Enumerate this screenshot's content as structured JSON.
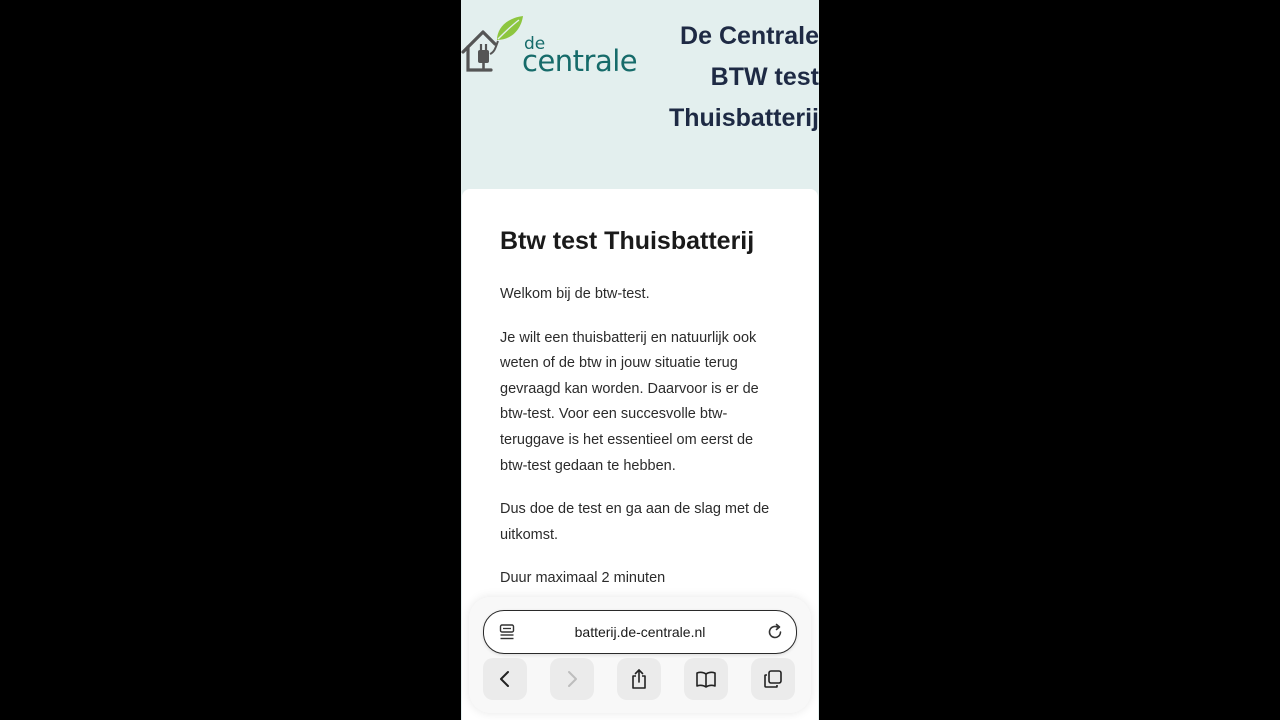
{
  "header": {
    "logo": {
      "small": "de",
      "large": "centrale"
    },
    "title_lines": [
      "De Centrale",
      "BTW test",
      "Thuisbatterij"
    ]
  },
  "card": {
    "title": "Btw test Thuisbatterij",
    "paragraphs": [
      "Welkom bij de btw-test.",
      "Je wilt een thuisbatterij en natuurlijk ook weten of de btw in jouw situatie terug gevraagd kan worden. Daarvoor is er de btw-test. Voor een succesvolle btw-teruggave is het essentieel om eerst de btw-test gedaan te hebben.",
      "Dus doe de test en ga aan de slag met de uitkomst.",
      "Duur maximaal 2 minuten"
    ]
  },
  "browser": {
    "url": "batterij.de-centrale.nl",
    "icons": {
      "reader": "reader-mode-icon",
      "reload": "reload-icon",
      "back": "chevron-left-icon",
      "forward": "chevron-right-icon",
      "share": "share-icon",
      "bookmarks": "book-icon",
      "tabs": "tabs-icon"
    }
  },
  "colors": {
    "header_bg": "#e3efee",
    "brand_teal": "#166b6a",
    "brand_green": "#8dc63f",
    "title_navy": "#1e2a44"
  }
}
